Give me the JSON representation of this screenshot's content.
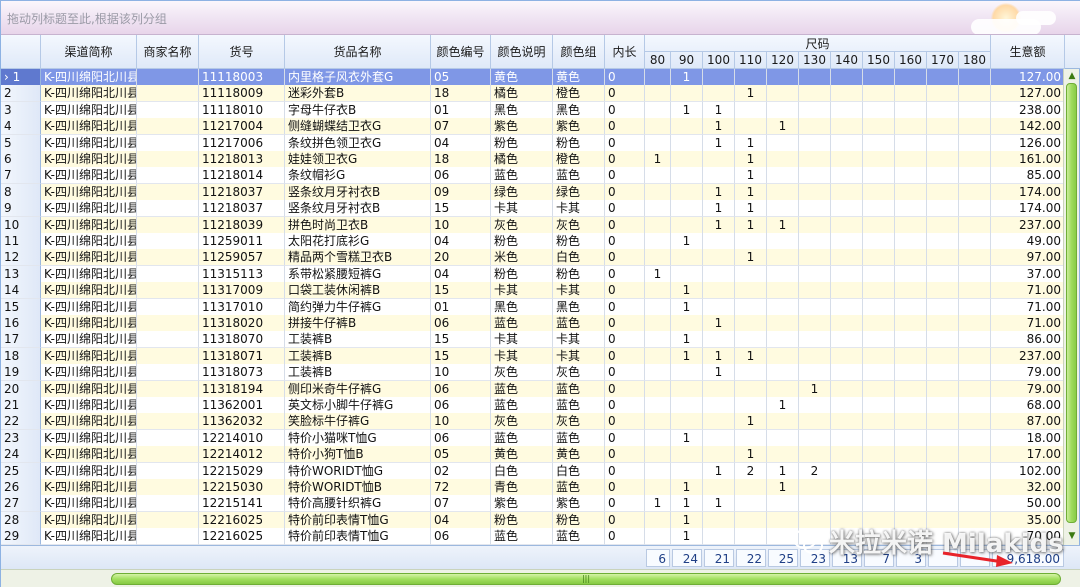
{
  "group_panel": {
    "hint": "拖动列标题至此,根据该列分组"
  },
  "columns": {
    "channel": "渠道简称",
    "merchant": "商家名称",
    "sku": "货号",
    "name": "货品名称",
    "color_code": "颜色编号",
    "color_desc": "颜色说明",
    "color_group": "颜色组",
    "inner_len": "内长",
    "size_group": "尺码",
    "sizes": [
      "80",
      "90",
      "100",
      "110",
      "120",
      "130",
      "140",
      "150",
      "160",
      "170",
      "180"
    ],
    "amount": "生意额"
  },
  "rows": [
    {
      "n": "1",
      "channel": "K-四川绵阳北川县",
      "merchant": "",
      "sku": "11118003",
      "name": "内里格子风衣外套G",
      "cc": "05",
      "cd": "黄色",
      "cg": "黄色",
      "il": "0",
      "s": [
        "",
        "1",
        "",
        "",
        "",
        "",
        "",
        "",
        "",
        "",
        ""
      ],
      "amt": "127.00",
      "selected": true
    },
    {
      "n": "2",
      "channel": "K-四川绵阳北川县",
      "merchant": "",
      "sku": "11118009",
      "name": "迷彩外套B",
      "cc": "18",
      "cd": "橘色",
      "cg": "橙色",
      "il": "0",
      "s": [
        "",
        "",
        "",
        "1",
        "",
        "",
        "",
        "",
        "",
        "",
        ""
      ],
      "amt": "127.00"
    },
    {
      "n": "3",
      "channel": "K-四川绵阳北川县",
      "merchant": "",
      "sku": "11118010",
      "name": "字母牛仔衣B",
      "cc": "01",
      "cd": "黑色",
      "cg": "黑色",
      "il": "0",
      "s": [
        "",
        "1",
        "1",
        "",
        "",
        "",
        "",
        "",
        "",
        "",
        ""
      ],
      "amt": "238.00"
    },
    {
      "n": "4",
      "channel": "K-四川绵阳北川县",
      "merchant": "",
      "sku": "11217004",
      "name": "侧缝蝴蝶结卫衣G",
      "cc": "07",
      "cd": "紫色",
      "cg": "紫色",
      "il": "0",
      "s": [
        "",
        "",
        "1",
        "",
        "1",
        "",
        "",
        "",
        "",
        "",
        ""
      ],
      "amt": "142.00"
    },
    {
      "n": "5",
      "channel": "K-四川绵阳北川县",
      "merchant": "",
      "sku": "11217006",
      "name": "条纹拼色领卫衣G",
      "cc": "04",
      "cd": "粉色",
      "cg": "粉色",
      "il": "0",
      "s": [
        "",
        "",
        "1",
        "1",
        "",
        "",
        "",
        "",
        "",
        "",
        ""
      ],
      "amt": "126.00"
    },
    {
      "n": "6",
      "channel": "K-四川绵阳北川县",
      "merchant": "",
      "sku": "11218013",
      "name": "娃娃领卫衣G",
      "cc": "18",
      "cd": "橘色",
      "cg": "橙色",
      "il": "0",
      "s": [
        "1",
        "",
        "",
        "1",
        "",
        "",
        "",
        "",
        "",
        "",
        ""
      ],
      "amt": "161.00"
    },
    {
      "n": "7",
      "channel": "K-四川绵阳北川县",
      "merchant": "",
      "sku": "11218014",
      "name": "条纹帽衫G",
      "cc": "06",
      "cd": "蓝色",
      "cg": "蓝色",
      "il": "0",
      "s": [
        "",
        "",
        "",
        "1",
        "",
        "",
        "",
        "",
        "",
        "",
        ""
      ],
      "amt": "85.00"
    },
    {
      "n": "8",
      "channel": "K-四川绵阳北川县",
      "merchant": "",
      "sku": "11218037",
      "name": "竖条纹月牙衬衣B",
      "cc": "09",
      "cd": "绿色",
      "cg": "绿色",
      "il": "0",
      "s": [
        "",
        "",
        "1",
        "1",
        "",
        "",
        "",
        "",
        "",
        "",
        ""
      ],
      "amt": "174.00"
    },
    {
      "n": "9",
      "channel": "K-四川绵阳北川县",
      "merchant": "",
      "sku": "11218037",
      "name": "竖条纹月牙衬衣B",
      "cc": "15",
      "cd": "卡其",
      "cg": "卡其",
      "il": "0",
      "s": [
        "",
        "",
        "1",
        "1",
        "",
        "",
        "",
        "",
        "",
        "",
        ""
      ],
      "amt": "174.00"
    },
    {
      "n": "10",
      "channel": "K-四川绵阳北川县",
      "merchant": "",
      "sku": "11218039",
      "name": "拼色时尚卫衣B",
      "cc": "10",
      "cd": "灰色",
      "cg": "灰色",
      "il": "0",
      "s": [
        "",
        "",
        "1",
        "1",
        "1",
        "",
        "",
        "",
        "",
        "",
        ""
      ],
      "amt": "237.00"
    },
    {
      "n": "11",
      "channel": "K-四川绵阳北川县",
      "merchant": "",
      "sku": "11259011",
      "name": "太阳花打底衫G",
      "cc": "04",
      "cd": "粉色",
      "cg": "粉色",
      "il": "0",
      "s": [
        "",
        "1",
        "",
        "",
        "",
        "",
        "",
        "",
        "",
        "",
        ""
      ],
      "amt": "49.00"
    },
    {
      "n": "12",
      "channel": "K-四川绵阳北川县",
      "merchant": "",
      "sku": "11259057",
      "name": "精品两个雪糕卫衣B",
      "cc": "20",
      "cd": "米色",
      "cg": "白色",
      "il": "0",
      "s": [
        "",
        "",
        "",
        "1",
        "",
        "",
        "",
        "",
        "",
        "",
        ""
      ],
      "amt": "97.00"
    },
    {
      "n": "13",
      "channel": "K-四川绵阳北川县",
      "merchant": "",
      "sku": "11315113",
      "name": "系带松紧腰短裤G",
      "cc": "04",
      "cd": "粉色",
      "cg": "粉色",
      "il": "0",
      "s": [
        "1",
        "",
        "",
        "",
        "",
        "",
        "",
        "",
        "",
        "",
        ""
      ],
      "amt": "37.00"
    },
    {
      "n": "14",
      "channel": "K-四川绵阳北川县",
      "merchant": "",
      "sku": "11317009",
      "name": "口袋工装休闲裤B",
      "cc": "15",
      "cd": "卡其",
      "cg": "卡其",
      "il": "0",
      "s": [
        "",
        "1",
        "",
        "",
        "",
        "",
        "",
        "",
        "",
        "",
        ""
      ],
      "amt": "71.00"
    },
    {
      "n": "15",
      "channel": "K-四川绵阳北川县",
      "merchant": "",
      "sku": "11317010",
      "name": "简约弹力牛仔裤G",
      "cc": "01",
      "cd": "黑色",
      "cg": "黑色",
      "il": "0",
      "s": [
        "",
        "1",
        "",
        "",
        "",
        "",
        "",
        "",
        "",
        "",
        ""
      ],
      "amt": "71.00"
    },
    {
      "n": "16",
      "channel": "K-四川绵阳北川县",
      "merchant": "",
      "sku": "11318020",
      "name": "拼接牛仔裤B",
      "cc": "06",
      "cd": "蓝色",
      "cg": "蓝色",
      "il": "0",
      "s": [
        "",
        "",
        "1",
        "",
        "",
        "",
        "",
        "",
        "",
        "",
        ""
      ],
      "amt": "71.00"
    },
    {
      "n": "17",
      "channel": "K-四川绵阳北川县",
      "merchant": "",
      "sku": "11318070",
      "name": "工装裤B",
      "cc": "15",
      "cd": "卡其",
      "cg": "卡其",
      "il": "0",
      "s": [
        "",
        "1",
        "",
        "",
        "",
        "",
        "",
        "",
        "",
        "",
        ""
      ],
      "amt": "86.00"
    },
    {
      "n": "18",
      "channel": "K-四川绵阳北川县",
      "merchant": "",
      "sku": "11318071",
      "name": "工装裤B",
      "cc": "15",
      "cd": "卡其",
      "cg": "卡其",
      "il": "0",
      "s": [
        "",
        "1",
        "1",
        "1",
        "",
        "",
        "",
        "",
        "",
        "",
        ""
      ],
      "amt": "237.00"
    },
    {
      "n": "19",
      "channel": "K-四川绵阳北川县",
      "merchant": "",
      "sku": "11318073",
      "name": "工装裤B",
      "cc": "10",
      "cd": "灰色",
      "cg": "灰色",
      "il": "0",
      "s": [
        "",
        "",
        "1",
        "",
        "",
        "",
        "",
        "",
        "",
        "",
        ""
      ],
      "amt": "79.00"
    },
    {
      "n": "20",
      "channel": "K-四川绵阳北川县",
      "merchant": "",
      "sku": "11318194",
      "name": "侧印米奇牛仔裤G",
      "cc": "06",
      "cd": "蓝色",
      "cg": "蓝色",
      "il": "0",
      "s": [
        "",
        "",
        "",
        "",
        "",
        "1",
        "",
        "",
        "",
        "",
        ""
      ],
      "amt": "79.00"
    },
    {
      "n": "21",
      "channel": "K-四川绵阳北川县",
      "merchant": "",
      "sku": "11362001",
      "name": "英文标小脚牛仔裤G",
      "cc": "06",
      "cd": "蓝色",
      "cg": "蓝色",
      "il": "0",
      "s": [
        "",
        "",
        "",
        "",
        "1",
        "",
        "",
        "",
        "",
        "",
        ""
      ],
      "amt": "68.00"
    },
    {
      "n": "22",
      "channel": "K-四川绵阳北川县",
      "merchant": "",
      "sku": "11362032",
      "name": "笑脸标牛仔裤G",
      "cc": "10",
      "cd": "灰色",
      "cg": "灰色",
      "il": "0",
      "s": [
        "",
        "",
        "",
        "1",
        "",
        "",
        "",
        "",
        "",
        "",
        ""
      ],
      "amt": "87.00"
    },
    {
      "n": "23",
      "channel": "K-四川绵阳北川县",
      "merchant": "",
      "sku": "12214010",
      "name": "特价小猫咪T恤G",
      "cc": "06",
      "cd": "蓝色",
      "cg": "蓝色",
      "il": "0",
      "s": [
        "",
        "1",
        "",
        "",
        "",
        "",
        "",
        "",
        "",
        "",
        ""
      ],
      "amt": "18.00"
    },
    {
      "n": "24",
      "channel": "K-四川绵阳北川县",
      "merchant": "",
      "sku": "12214012",
      "name": "特价小狗T恤B",
      "cc": "05",
      "cd": "黄色",
      "cg": "黄色",
      "il": "0",
      "s": [
        "",
        "",
        "",
        "1",
        "",
        "",
        "",
        "",
        "",
        "",
        ""
      ],
      "amt": "17.00"
    },
    {
      "n": "25",
      "channel": "K-四川绵阳北川县",
      "merchant": "",
      "sku": "12215029",
      "name": "特价WORIDT恤G",
      "cc": "02",
      "cd": "白色",
      "cg": "白色",
      "il": "0",
      "s": [
        "",
        "",
        "1",
        "2",
        "1",
        "2",
        "",
        "",
        "",
        "",
        ""
      ],
      "amt": "102.00"
    },
    {
      "n": "26",
      "channel": "K-四川绵阳北川县",
      "merchant": "",
      "sku": "12215030",
      "name": "特价WORIDT恤B",
      "cc": "72",
      "cd": "青色",
      "cg": "蓝色",
      "il": "0",
      "s": [
        "",
        "1",
        "",
        "",
        "1",
        "",
        "",
        "",
        "",
        "",
        ""
      ],
      "amt": "32.00"
    },
    {
      "n": "27",
      "channel": "K-四川绵阳北川县",
      "merchant": "",
      "sku": "12215141",
      "name": "特价高腰针织裤G",
      "cc": "07",
      "cd": "紫色",
      "cg": "紫色",
      "il": "0",
      "s": [
        "1",
        "1",
        "1",
        "",
        "",
        "",
        "",
        "",
        "",
        "",
        ""
      ],
      "amt": "50.00"
    },
    {
      "n": "28",
      "channel": "K-四川绵阳北川县",
      "merchant": "",
      "sku": "12216025",
      "name": "特价前印表情T恤G",
      "cc": "04",
      "cd": "粉色",
      "cg": "粉色",
      "il": "0",
      "s": [
        "",
        "1",
        "",
        "",
        "",
        "",
        "",
        "",
        "",
        "",
        ""
      ],
      "amt": "35.00"
    },
    {
      "n": "29",
      "channel": "K-四川绵阳北川县",
      "merchant": "",
      "sku": "12216025",
      "name": "特价前印表情T恤G",
      "cc": "06",
      "cd": "蓝色",
      "cg": "蓝色",
      "il": "0",
      "s": [
        "",
        "1",
        "",
        "",
        "",
        "",
        "",
        "",
        "",
        "",
        ""
      ],
      "amt": "70.00"
    }
  ],
  "totals": {
    "sizes": [
      "6",
      "24",
      "21",
      "22",
      "25",
      "23",
      "13",
      "7",
      "3",
      "",
      ""
    ],
    "amount": "9,618.00"
  },
  "watermark": {
    "text": "米拉米诺 Milakids"
  },
  "colors": {
    "header_bg": "#dfe9f8",
    "row_alt_bg": "#fffbe0",
    "selected_bg": "#7f97e6",
    "scroll_green": "#9edb5d",
    "total_text": "#1f3f86",
    "arrow_red": "#e8232a"
  }
}
